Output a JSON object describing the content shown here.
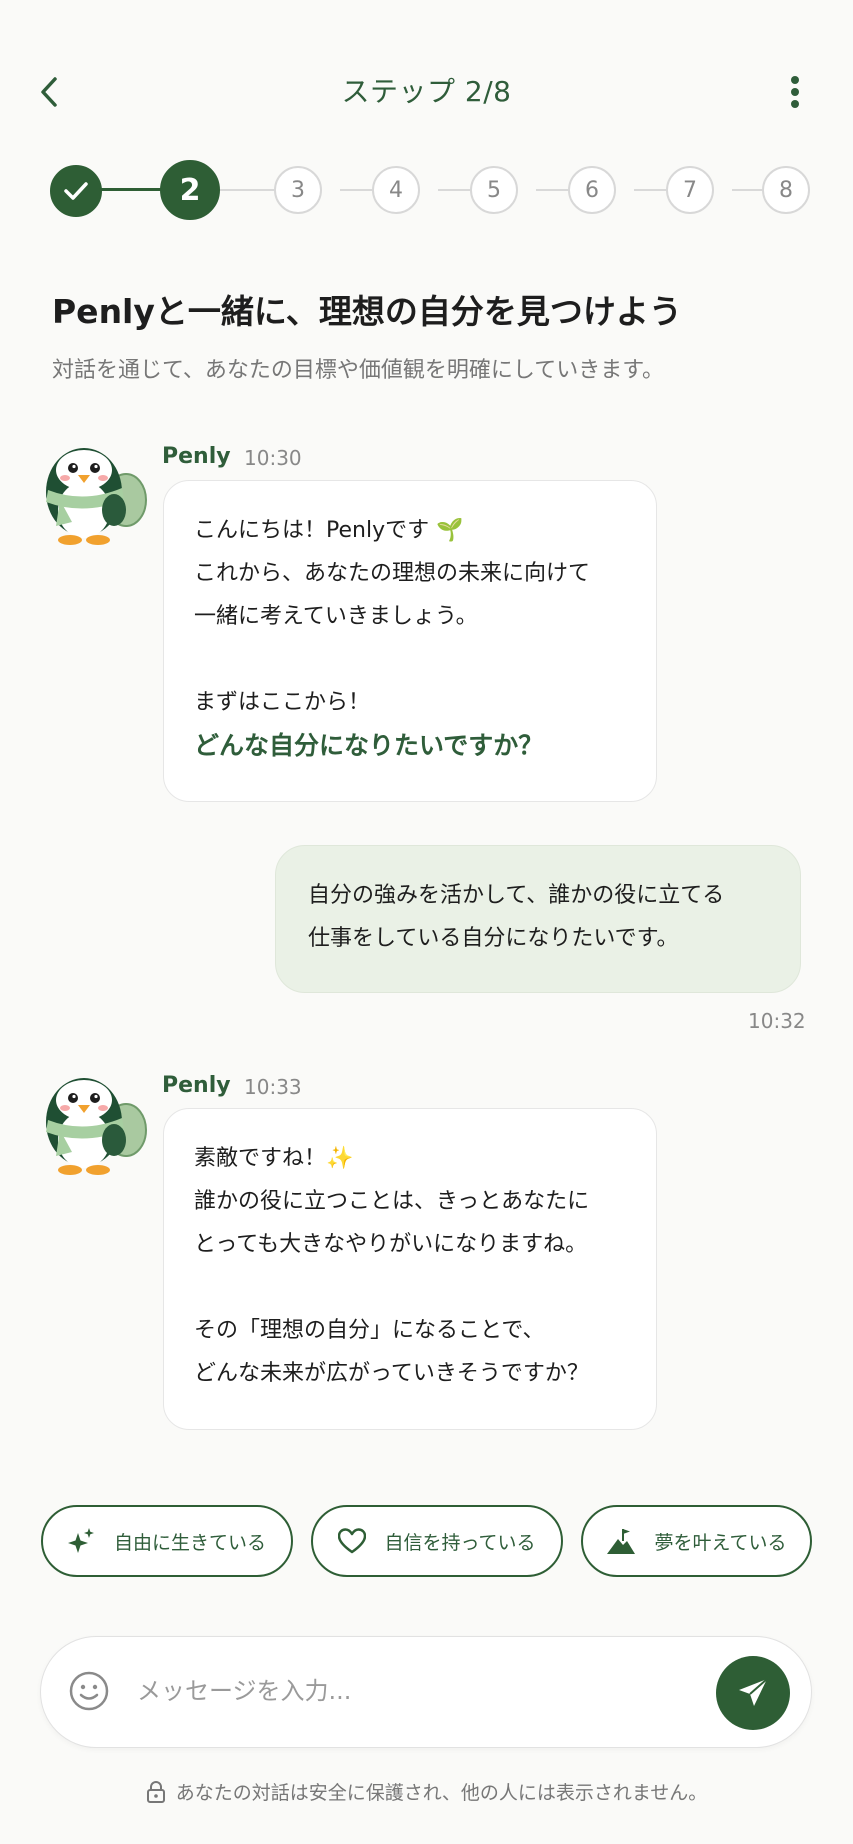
{
  "header": {
    "title": "ステップ 2/8"
  },
  "stepper": {
    "steps": [
      "1",
      "2",
      "3",
      "4",
      "5",
      "6",
      "7",
      "8"
    ],
    "current": 2
  },
  "intro": {
    "heading": "Penlyと一緒に、理想の自分を見つけよう",
    "subheading": "対話を通じて、あなたの目標や価値観を明確にしていきます。"
  },
  "messages": [
    {
      "sender": "Penly",
      "time": "10:30",
      "lines": [
        "こんにちは！Penlyです 🌱",
        "これから、あなたの理想の未来に向けて",
        "一緒に考えていきましょう。",
        "",
        "まずはここから！"
      ],
      "emphasis": "どんな自分になりたいですか？"
    },
    {
      "sender": "user",
      "time": "10:32",
      "lines": [
        "自分の強みを活かして、誰かの役に立てる",
        "仕事をしている自分になりたいです。"
      ]
    },
    {
      "sender": "Penly",
      "time": "10:33",
      "lines": [
        "素敵ですね！✨",
        "誰かの役に立つことは、きっとあなたに",
        "とっても大きなやりがいになりますね。",
        "",
        "その「理想の自分」になることで、",
        "どんな未来が広がっていきそうですか？"
      ]
    }
  ],
  "quick_replies": [
    {
      "label": "自由に生きている",
      "icon": "sparkle-icon"
    },
    {
      "label": "自信を持っている",
      "icon": "heart-icon"
    },
    {
      "label": "夢を叶えている",
      "icon": "mountain-flag-icon"
    }
  ],
  "input": {
    "placeholder": "メッセージを入力..."
  },
  "footer": {
    "privacy_note": "あなたの対話は安全に保護され、他の人には表示されません。"
  },
  "colors": {
    "primary": "#2e5e35",
    "user_bubble": "#eaf1e6",
    "background": "#fafaf8"
  }
}
